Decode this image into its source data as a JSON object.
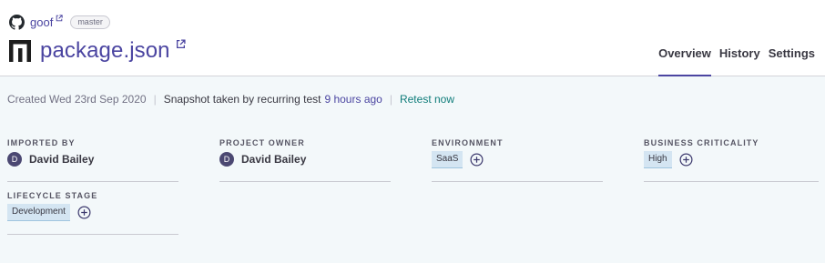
{
  "header": {
    "repo": "goof",
    "branch": "master",
    "title": "package.json",
    "tabs": [
      {
        "label": "Overview",
        "active": true
      },
      {
        "label": "History",
        "active": false
      },
      {
        "label": "Settings",
        "active": false
      }
    ]
  },
  "meta": {
    "created": "Created Wed 23rd Sep 2020",
    "snapshot": "Snapshot taken by recurring test",
    "ago": "9 hours ago",
    "retest": "Retest now"
  },
  "attributes": {
    "imported_by": {
      "label": "IMPORTED BY",
      "initial": "D",
      "name": "David Bailey"
    },
    "project_owner": {
      "label": "PROJECT OWNER",
      "initial": "D",
      "name": "David Bailey"
    },
    "environment": {
      "label": "ENVIRONMENT",
      "tag": "SaaS"
    },
    "business_criticality": {
      "label": "BUSINESS CRITICALITY",
      "tag": "High"
    },
    "lifecycle_stage": {
      "label": "LIFECYCLE STAGE",
      "tag": "Development"
    }
  },
  "icons": {
    "repo": "github-icon",
    "project": "npm-package-icon",
    "external": "external-link-icon",
    "add": "plus-circle-icon"
  },
  "colors": {
    "brand": "#4b45a1",
    "retest": "#0f7c7a",
    "tag_bg": "#d4e5f2",
    "content_bg": "#f3f8fa",
    "avatar_bg": "#4b4872"
  }
}
